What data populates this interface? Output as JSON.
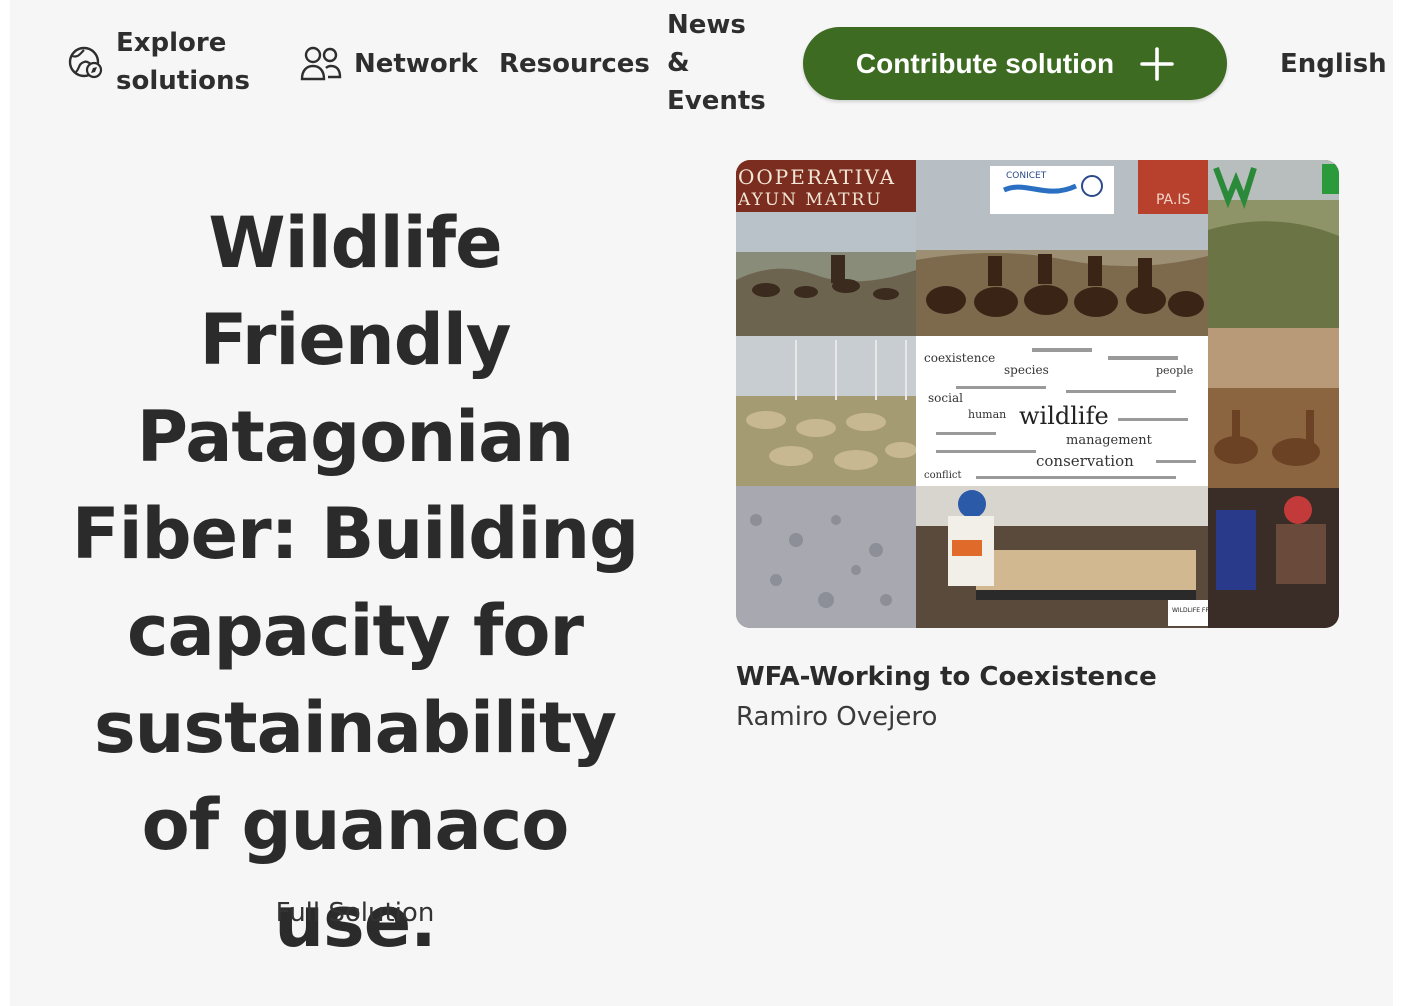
{
  "nav": {
    "explore_label": "Explore solutions",
    "network_label": "Network",
    "resources_label": "Resources",
    "news_line1": "News",
    "news_line2": "&",
    "news_line3": "Events",
    "contribute_label": "Contribute solution",
    "language_label": "English"
  },
  "hero": {
    "title": "Wildlife Friendly Patagonian Fiber: Building capacity for sustainability of guanaco use.",
    "solution_type": "Full Solution"
  },
  "image": {
    "banner_text_line1": "OOPERATIVA",
    "banner_text_line2": "AYUN MATRU",
    "logo_text": "CONICET",
    "pais_text": "PA.IS",
    "word_cloud": {
      "big": "wildlife",
      "medium1": "conservation",
      "medium2": "management",
      "small1": "coexistence",
      "small2": "species",
      "small3": "social",
      "small4": "human",
      "small5": "conflict",
      "small6": "people"
    },
    "badge_text": "WILDLIFE FRIENDLY",
    "caption_title": "WFA-Working to Coexistence",
    "caption_author": "Ramiro Ovejero"
  },
  "colors": {
    "accent_green": "#3e6b22",
    "background": "#f6f6f6",
    "text": "#2b2b2b"
  },
  "icons": {
    "explore": "globe-compass-icon",
    "network": "people-icon",
    "contribute": "plus-icon"
  }
}
